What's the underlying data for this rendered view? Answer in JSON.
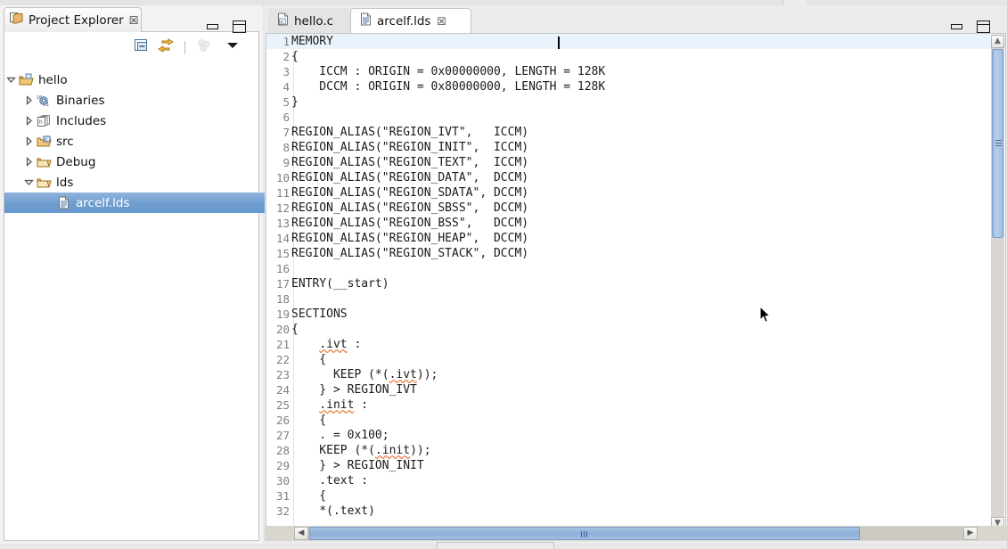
{
  "project_explorer": {
    "title": "Project Explorer",
    "close_glyph": "☒",
    "toolbar": [
      {
        "name": "collapse-all-icon",
        "title": "Collapse All"
      },
      {
        "name": "link-with-editor-icon",
        "title": "Link with Editor"
      },
      {
        "name": "focus-on-active-task-icon",
        "title": "Focus on Active Task"
      },
      {
        "name": "view-menu-icon",
        "title": "View Menu"
      }
    ],
    "window_buttons": [
      {
        "name": "minimize-button",
        "title": "Minimize"
      },
      {
        "name": "maximize-button",
        "title": "Maximize"
      }
    ],
    "tree": [
      {
        "label": "hello",
        "indent": 0,
        "twisty": "open",
        "icon": "project-folder-icon",
        "selected": false
      },
      {
        "label": "Binaries",
        "indent": 1,
        "twisty": "closed",
        "icon": "binaries-icon",
        "selected": false
      },
      {
        "label": "Includes",
        "indent": 1,
        "twisty": "closed",
        "icon": "includes-icon",
        "selected": false
      },
      {
        "label": "src",
        "indent": 1,
        "twisty": "closed",
        "icon": "source-folder-icon",
        "selected": false
      },
      {
        "label": "Debug",
        "indent": 1,
        "twisty": "closed",
        "icon": "folder-icon",
        "selected": false
      },
      {
        "label": "lds",
        "indent": 1,
        "twisty": "open",
        "icon": "folder-icon",
        "selected": false
      },
      {
        "label": "arcelf.lds",
        "indent": 2,
        "twisty": "none",
        "icon": "file-icon",
        "selected": true
      }
    ]
  },
  "editor": {
    "tabs": [
      {
        "label": "hello.c",
        "icon": "c-file-icon",
        "active": false,
        "closable": false
      },
      {
        "label": "arcelf.lds",
        "icon": "lds-file-icon",
        "active": true,
        "closable": true
      }
    ],
    "close_glyph": "☒",
    "window_buttons": [
      {
        "name": "minimize-button",
        "title": "Minimize"
      },
      {
        "name": "maximize-button",
        "title": "Maximize"
      }
    ],
    "current_line": 1,
    "lines": [
      {
        "n": 1,
        "text": "MEMORY"
      },
      {
        "n": 2,
        "text": "{"
      },
      {
        "n": 3,
        "text": "    ICCM : ORIGIN = 0x00000000, LENGTH = 128K"
      },
      {
        "n": 4,
        "text": "    DCCM : ORIGIN = 0x80000000, LENGTH = 128K"
      },
      {
        "n": 5,
        "text": "}"
      },
      {
        "n": 6,
        "text": ""
      },
      {
        "n": 7,
        "text": "REGION_ALIAS(\"REGION_IVT\",   ICCM)"
      },
      {
        "n": 8,
        "text": "REGION_ALIAS(\"REGION_INIT\",  ICCM)"
      },
      {
        "n": 9,
        "text": "REGION_ALIAS(\"REGION_TEXT\",  ICCM)"
      },
      {
        "n": 10,
        "text": "REGION_ALIAS(\"REGION_DATA\",  DCCM)"
      },
      {
        "n": 11,
        "text": "REGION_ALIAS(\"REGION_SDATA\", DCCM)"
      },
      {
        "n": 12,
        "text": "REGION_ALIAS(\"REGION_SBSS\",  DCCM)"
      },
      {
        "n": 13,
        "text": "REGION_ALIAS(\"REGION_BSS\",   DCCM)"
      },
      {
        "n": 14,
        "text": "REGION_ALIAS(\"REGION_HEAP\",  DCCM)"
      },
      {
        "n": 15,
        "text": "REGION_ALIAS(\"REGION_STACK\", DCCM)"
      },
      {
        "n": 16,
        "text": ""
      },
      {
        "n": 17,
        "text": "ENTRY(__start)"
      },
      {
        "n": 18,
        "text": ""
      },
      {
        "n": 19,
        "text": "SECTIONS"
      },
      {
        "n": 20,
        "text": "{"
      },
      {
        "n": 21,
        "text": "    .ivt :"
      },
      {
        "n": 22,
        "text": "    {"
      },
      {
        "n": 23,
        "text": "      KEEP (*(.ivt));"
      },
      {
        "n": 24,
        "text": "    } > REGION_IVT"
      },
      {
        "n": 25,
        "text": "    .init :"
      },
      {
        "n": 26,
        "text": "    {"
      },
      {
        "n": 27,
        "text": "    . = 0x100;"
      },
      {
        "n": 28,
        "text": "    KEEP (*(.init));"
      },
      {
        "n": 29,
        "text": "    } > REGION_INIT"
      },
      {
        "n": 30,
        "text": "    .text :"
      },
      {
        "n": 31,
        "text": "    {"
      },
      {
        "n": 32,
        "text": "    *(.text)"
      }
    ],
    "vertical_scrollbar": {
      "name": "editor-vertical-scrollbar",
      "up_glyph": "▲",
      "down_glyph": "▼"
    },
    "horizontal_scrollbar": {
      "name": "editor-horizontal-scrollbar",
      "left_glyph": "◀",
      "right_glyph": "▶"
    }
  },
  "colors": {
    "selection_blue": "#659ad2",
    "current_line": "#eaf2fb",
    "spellcheck_underline": "#e8834a",
    "line_number": "#808080"
  }
}
